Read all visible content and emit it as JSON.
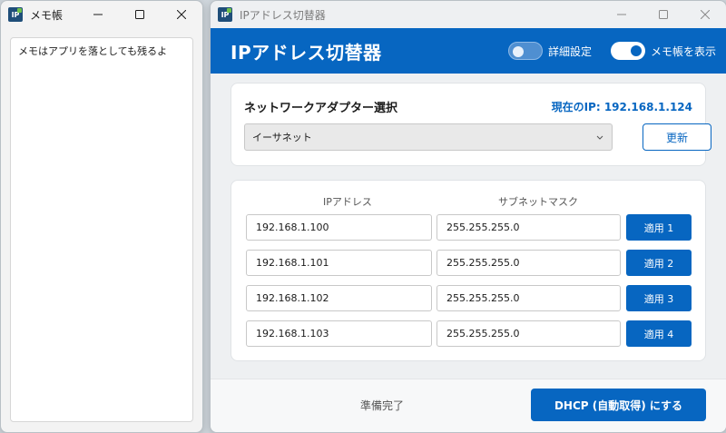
{
  "memo_window": {
    "title": "メモ帳",
    "icon": "ip-app-icon",
    "content": "メモはアプリを落としても残るよ"
  },
  "ip_window": {
    "title": "IPアドレス切替器",
    "header_title": "IPアドレス切替器",
    "toggles": [
      {
        "label": "詳細設定",
        "on": false
      },
      {
        "label": "メモ帳を表示",
        "on": true
      }
    ],
    "adapter": {
      "heading": "ネットワークアダプター選択",
      "current_ip": "現在のIP: 192.168.1.124",
      "selected": "イーサネット",
      "refresh_label": "更新"
    },
    "ip_table": {
      "headers": {
        "ip": "IPアドレス",
        "mask": "サブネットマスク"
      },
      "rows": [
        {
          "ip": "192.168.1.100",
          "mask": "255.255.255.0",
          "button": "適用 1"
        },
        {
          "ip": "192.168.1.101",
          "mask": "255.255.255.0",
          "button": "適用 2"
        },
        {
          "ip": "192.168.1.102",
          "mask": "255.255.255.0",
          "button": "適用 3"
        },
        {
          "ip": "192.168.1.103",
          "mask": "255.255.255.0",
          "button": "適用 4"
        }
      ]
    },
    "footer": {
      "status": "準備完了",
      "dhcp_label": "DHCP (自動取得) にする"
    }
  },
  "colors": {
    "accent": "#0766c1",
    "background": "#eef0f2"
  }
}
